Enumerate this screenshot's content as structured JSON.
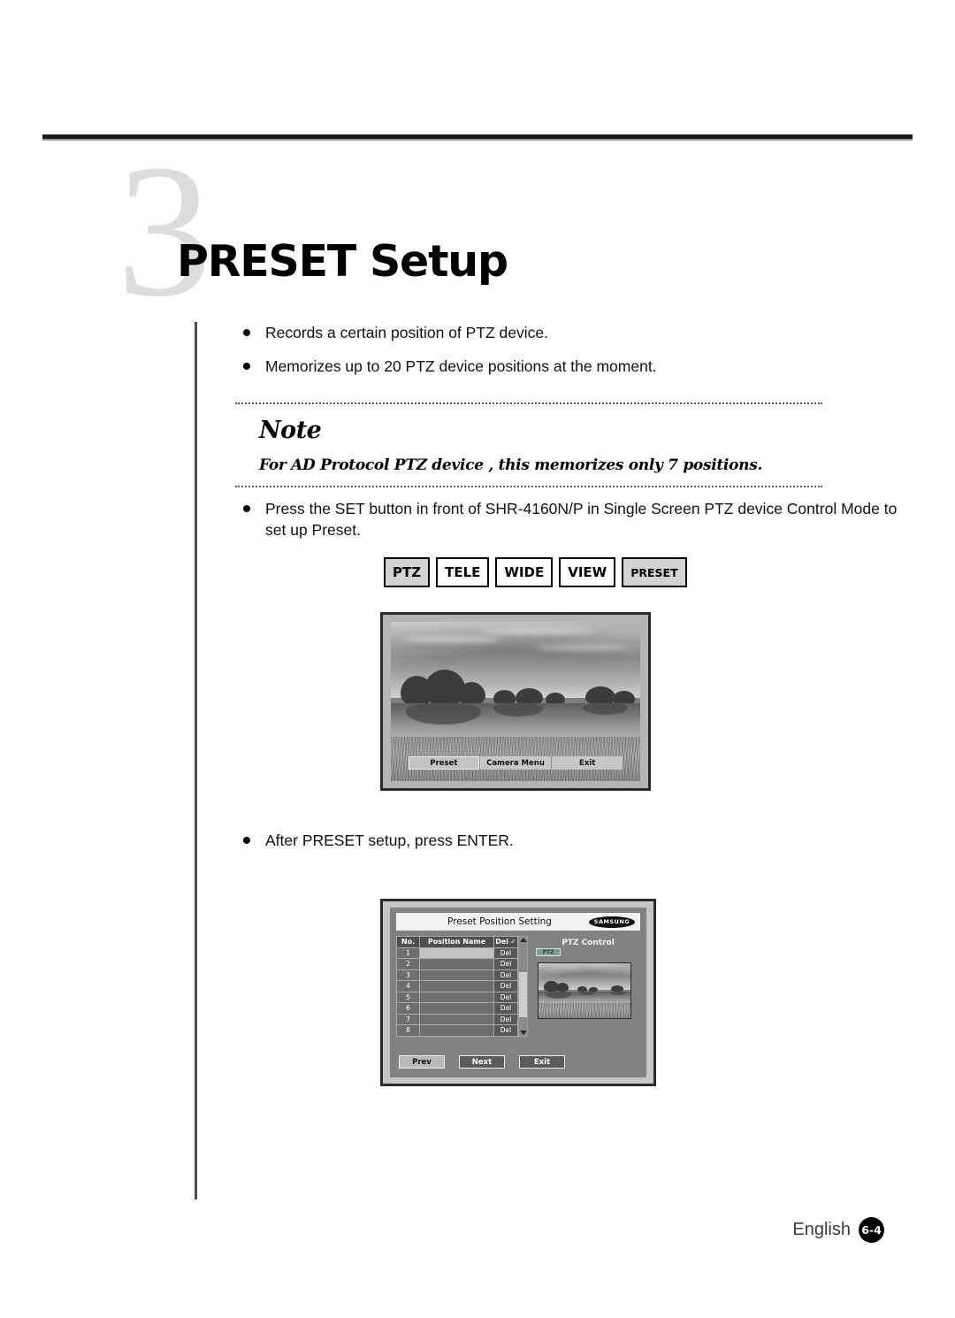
{
  "page": {
    "chapter_number": "3",
    "chapter_title": "PRESET Setup"
  },
  "intro_bullets": [
    "Records a certain position of PTZ device.",
    "Memorizes up to 20 PTZ device positions at the moment."
  ],
  "note": {
    "label": "Note",
    "text": "For AD Protocol PTZ device , this memorizes only 7 positions."
  },
  "instruction_bullets": [
    "Press the SET button in front of SHR-4160N/P in Single Screen PTZ device Control Mode to set up Preset.",
    "After PRESET setup, press ENTER."
  ],
  "keys": [
    {
      "label": "PTZ",
      "active": true
    },
    {
      "label": "TELE",
      "active": false
    },
    {
      "label": "WIDE",
      "active": false
    },
    {
      "label": "VIEW",
      "active": false
    },
    {
      "label": "PRESET",
      "active": true
    }
  ],
  "monitor_osd": {
    "items": [
      {
        "label": "Preset",
        "selected": true
      },
      {
        "label": "Camera Menu",
        "selected": false
      },
      {
        "label": "Exit",
        "selected": false
      }
    ]
  },
  "preset_dialog": {
    "title": "Preset Position Setting",
    "brand": "SAMSUNG",
    "columns": [
      "No.",
      "Position Name",
      "Del"
    ],
    "header_check": "✓",
    "rows": [
      {
        "no": "1",
        "name": "",
        "del": "Del",
        "selected": true
      },
      {
        "no": "2",
        "name": "",
        "del": "Del",
        "selected": false
      },
      {
        "no": "3",
        "name": "",
        "del": "Del",
        "selected": false
      },
      {
        "no": "4",
        "name": "",
        "del": "Del",
        "selected": false
      },
      {
        "no": "5",
        "name": "",
        "del": "Del",
        "selected": false
      },
      {
        "no": "6",
        "name": "",
        "del": "Del",
        "selected": false
      },
      {
        "no": "7",
        "name": "",
        "del": "Del",
        "selected": false
      },
      {
        "no": "8",
        "name": "",
        "del": "Del",
        "selected": false
      }
    ],
    "ptz_control_title": "PTZ Control",
    "ptz_badge": "PTZ",
    "buttons": [
      {
        "label": "Prev",
        "selected": true
      },
      {
        "label": "Next",
        "selected": false
      },
      {
        "label": "Exit",
        "selected": false
      }
    ]
  },
  "footer": {
    "language": "English",
    "page_number": "6-4"
  },
  "colors": {
    "chapter_number": "#dcdcdc",
    "rule": "#1a1a1a",
    "key_active_bg": "#d3d3d3",
    "dialog_bg": "#828282",
    "ptz_badge_bg": "#7f9e92"
  }
}
